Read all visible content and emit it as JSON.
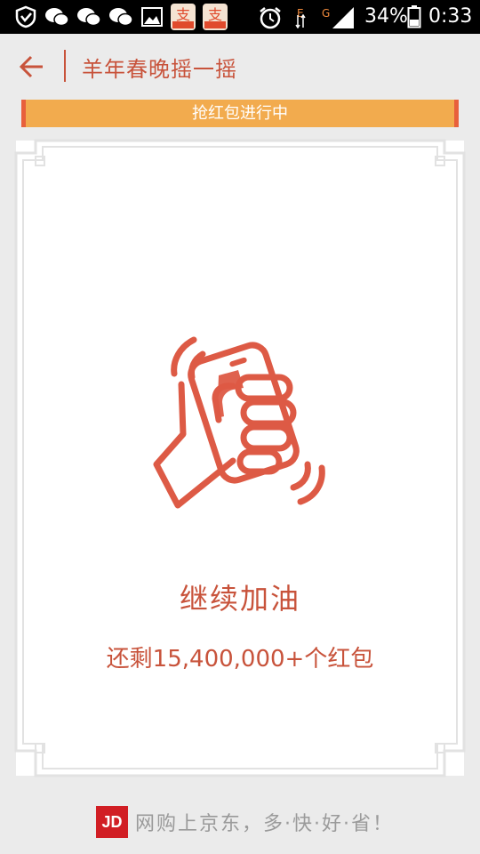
{
  "status_bar": {
    "battery": "34%",
    "time": "0:33",
    "network_e": "E",
    "network_g": "G"
  },
  "header": {
    "title": "羊年春晚摇一摇"
  },
  "banner": {
    "text": "抢红包进行中"
  },
  "card": {
    "message": "继续加油",
    "remaining": "还剩15,400,000+个红包"
  },
  "footer": {
    "logo": "JD",
    "slogan": "网购上京东，多·快·好·省！"
  },
  "colors": {
    "accent": "#c8533b",
    "banner": "#f2ab4e",
    "jd_red": "#d11e24"
  }
}
